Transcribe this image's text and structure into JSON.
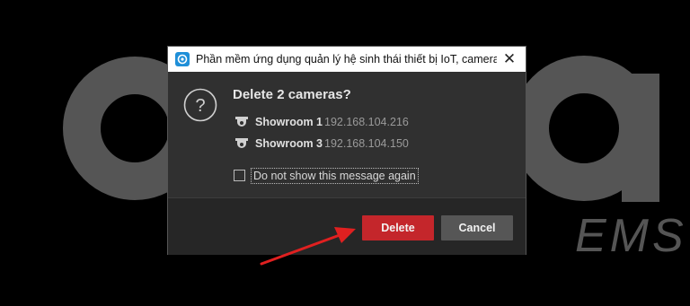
{
  "background": {
    "logo_letters": "OOKRA",
    "tagline": "EMS"
  },
  "dialog": {
    "title": "Phần mềm ứng dụng quản lý hệ sinh thái thiết bị IoT, camera...",
    "close_glyph": "✕",
    "message": "Delete 2 cameras?",
    "cameras": [
      {
        "name": "Showroom 1",
        "ip": "192.168.104.216"
      },
      {
        "name": "Showroom 3",
        "ip": "192.168.104.150"
      }
    ],
    "checkbox_label": "Do not show this message again",
    "checkbox_checked": false,
    "buttons": {
      "delete_label": "Delete",
      "cancel_label": "Cancel"
    }
  },
  "colors": {
    "delete_button": "#c4262b",
    "cancel_button": "#565656",
    "annotation_arrow": "#e02020"
  }
}
